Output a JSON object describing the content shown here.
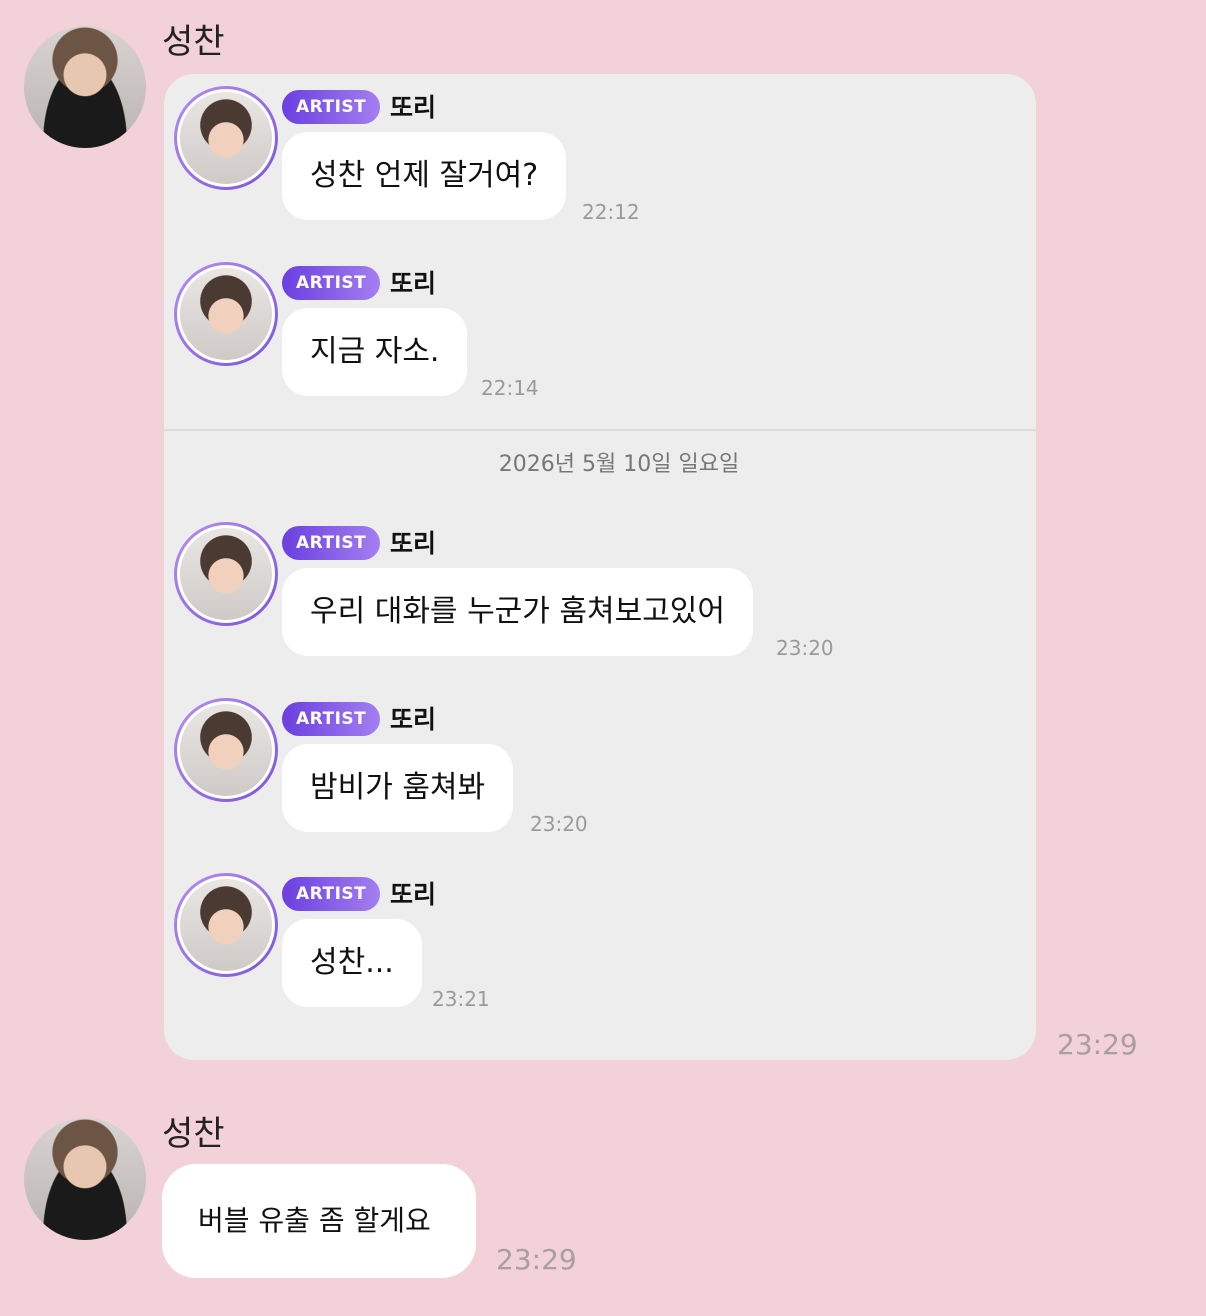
{
  "post1": {
    "sender": "성찬",
    "time": "23:29",
    "quoted_messages": [
      {
        "badge": "ARTIST",
        "name": "또리",
        "text": "성찬 언제 잘거여?",
        "time": "22:12"
      },
      {
        "badge": "ARTIST",
        "name": "또리",
        "text": "지금 자소.",
        "time": "22:14"
      },
      {
        "badge": "ARTIST",
        "name": "또리",
        "text": "우리 대화를 누군가 훔쳐보고있어",
        "time": "23:20"
      },
      {
        "badge": "ARTIST",
        "name": "또리",
        "text": "밤비가 훔쳐봐",
        "time": "23:20"
      },
      {
        "badge": "ARTIST",
        "name": "또리",
        "text": "성찬...",
        "time": "23:21"
      }
    ],
    "date_divider": "2026년 5월 10일 일요일"
  },
  "post2": {
    "sender": "성찬",
    "text": "버블 유출 좀 할게요",
    "time": "23:29"
  }
}
